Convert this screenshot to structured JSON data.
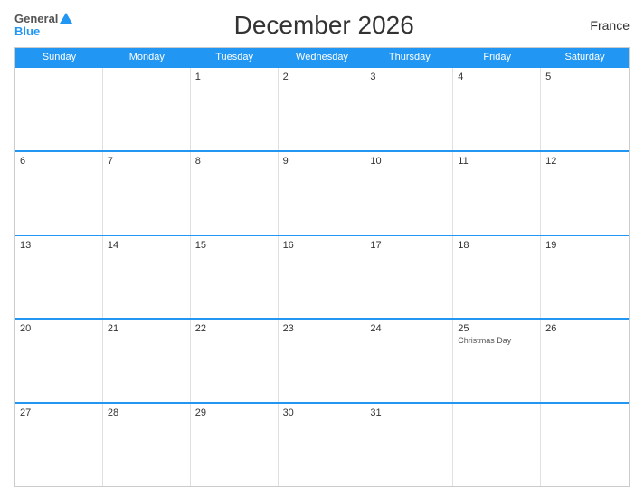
{
  "header": {
    "title": "December 2026",
    "country": "France",
    "logo_general": "General",
    "logo_blue": "Blue"
  },
  "days_of_week": [
    "Sunday",
    "Monday",
    "Tuesday",
    "Wednesday",
    "Thursday",
    "Friday",
    "Saturday"
  ],
  "weeks": [
    [
      {
        "num": "",
        "event": ""
      },
      {
        "num": "",
        "event": ""
      },
      {
        "num": "1",
        "event": ""
      },
      {
        "num": "2",
        "event": ""
      },
      {
        "num": "3",
        "event": ""
      },
      {
        "num": "4",
        "event": ""
      },
      {
        "num": "5",
        "event": ""
      }
    ],
    [
      {
        "num": "6",
        "event": ""
      },
      {
        "num": "7",
        "event": ""
      },
      {
        "num": "8",
        "event": ""
      },
      {
        "num": "9",
        "event": ""
      },
      {
        "num": "10",
        "event": ""
      },
      {
        "num": "11",
        "event": ""
      },
      {
        "num": "12",
        "event": ""
      }
    ],
    [
      {
        "num": "13",
        "event": ""
      },
      {
        "num": "14",
        "event": ""
      },
      {
        "num": "15",
        "event": ""
      },
      {
        "num": "16",
        "event": ""
      },
      {
        "num": "17",
        "event": ""
      },
      {
        "num": "18",
        "event": ""
      },
      {
        "num": "19",
        "event": ""
      }
    ],
    [
      {
        "num": "20",
        "event": ""
      },
      {
        "num": "21",
        "event": ""
      },
      {
        "num": "22",
        "event": ""
      },
      {
        "num": "23",
        "event": ""
      },
      {
        "num": "24",
        "event": ""
      },
      {
        "num": "25",
        "event": "Christmas Day"
      },
      {
        "num": "26",
        "event": ""
      }
    ],
    [
      {
        "num": "27",
        "event": ""
      },
      {
        "num": "28",
        "event": ""
      },
      {
        "num": "29",
        "event": ""
      },
      {
        "num": "30",
        "event": ""
      },
      {
        "num": "31",
        "event": ""
      },
      {
        "num": "",
        "event": ""
      },
      {
        "num": "",
        "event": ""
      }
    ]
  ]
}
